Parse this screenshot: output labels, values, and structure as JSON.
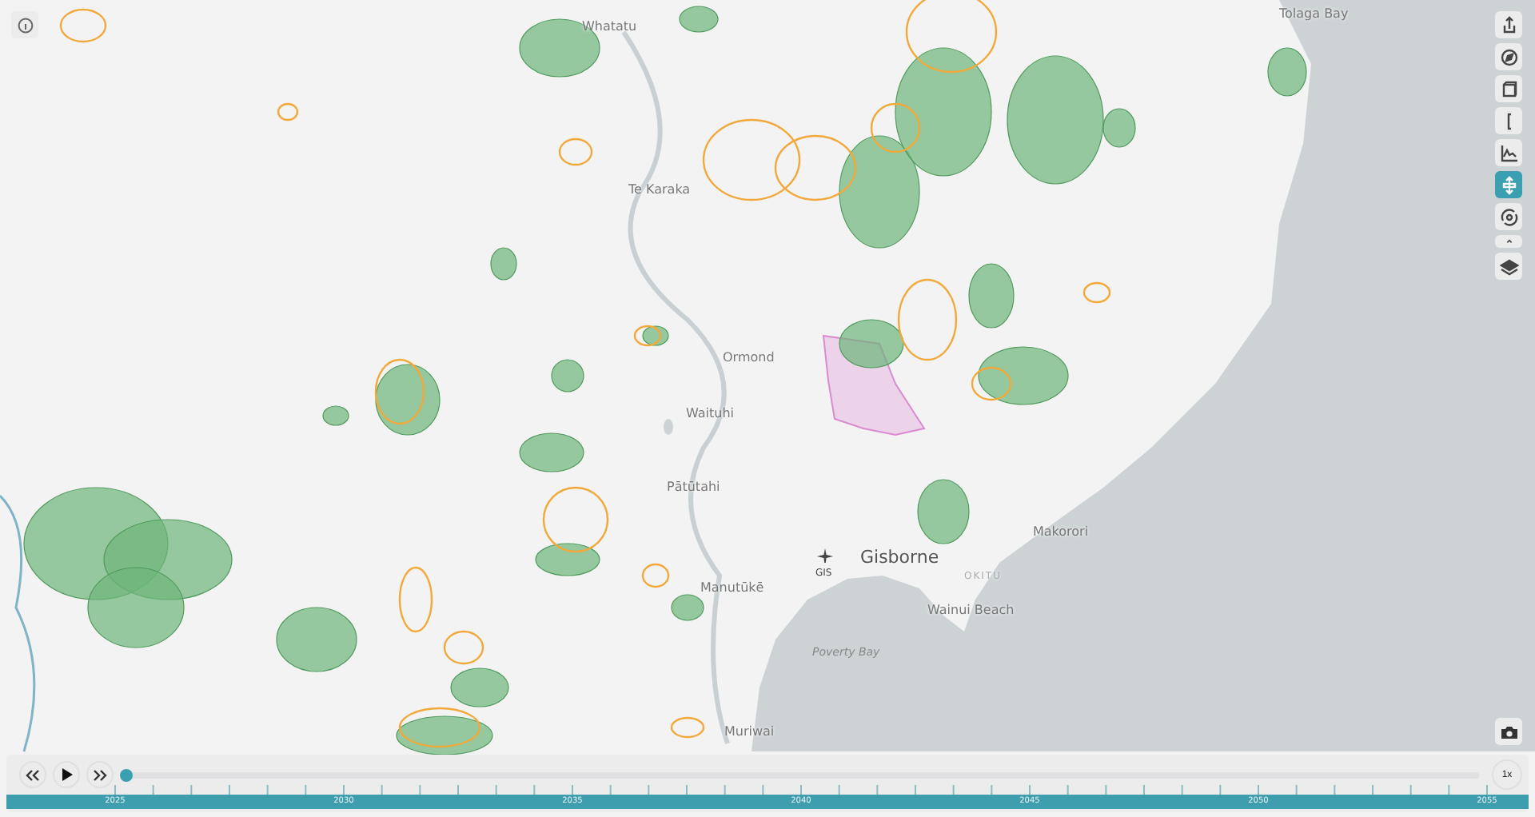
{
  "map": {
    "labels": [
      {
        "text": "Whatatu",
        "kind": "town"
      },
      {
        "text": "Tolaga Bay",
        "kind": "town"
      },
      {
        "text": "Te Karaka",
        "kind": "town"
      },
      {
        "text": "Ormond",
        "kind": "town"
      },
      {
        "text": "Waituhi",
        "kind": "town"
      },
      {
        "text": "Pātūtahi",
        "kind": "town"
      },
      {
        "text": "Manutūkē",
        "kind": "town"
      },
      {
        "text": "Gisborne",
        "kind": "city"
      },
      {
        "text": "GIS",
        "kind": "airport"
      },
      {
        "text": "OKITU",
        "kind": "suburb"
      },
      {
        "text": "Makorori",
        "kind": "town"
      },
      {
        "text": "Wainui Beach",
        "kind": "town"
      },
      {
        "text": "Poverty Bay",
        "kind": "water"
      },
      {
        "text": "Muriwai",
        "kind": "town"
      }
    ]
  },
  "toolbar": [
    {
      "kind": "share",
      "selected": false
    },
    {
      "kind": "compass",
      "selected": false
    },
    {
      "kind": "box",
      "selected": false
    },
    {
      "kind": "bracket",
      "selected": false
    },
    {
      "kind": "chart",
      "selected": false
    },
    {
      "kind": "pan",
      "selected": true
    },
    {
      "kind": "rotate",
      "selected": false
    },
    {
      "kind": "caret",
      "selected": false
    },
    {
      "kind": "layers",
      "selected": false
    }
  ],
  "timeline": {
    "level": 0,
    "speed": "1x",
    "years": [
      "2025",
      "2030",
      "2035",
      "2040",
      "2045",
      "2050",
      "2055"
    ]
  }
}
